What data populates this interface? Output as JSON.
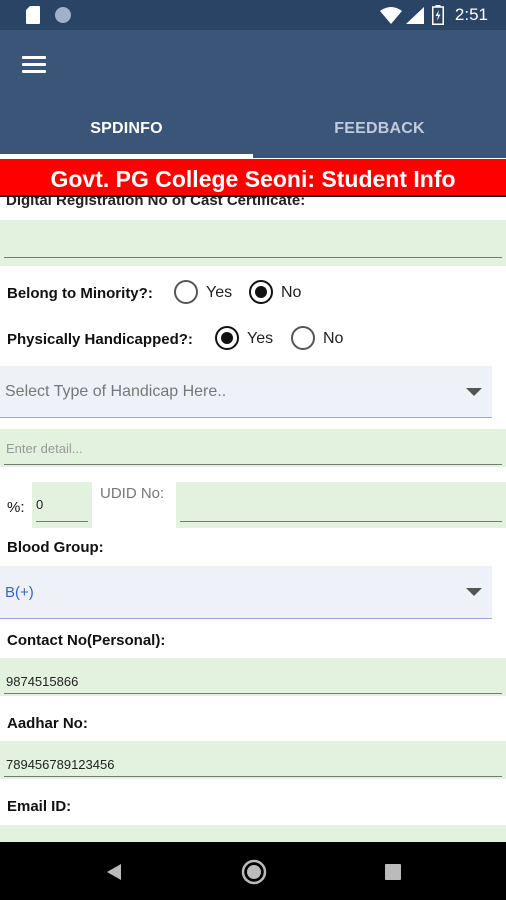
{
  "status_bar": {
    "time": "2:51",
    "left_icons": [
      "sd-card-icon",
      "circle-notification-icon"
    ],
    "right_icons": [
      "wifi-icon",
      "signal-icon",
      "battery-icon"
    ]
  },
  "app_bar": {
    "menu_icon": "hamburger-menu-icon",
    "tabs": [
      {
        "label": "SPDINFO",
        "active": true
      },
      {
        "label": "FEEDBACK",
        "active": false
      }
    ]
  },
  "banner": {
    "title": "Govt. PG College Seoni: Student Info"
  },
  "form": {
    "cut_label": "Digital Registration No of Cast Certificate:",
    "minority": {
      "label": "Belong to Minority?:",
      "options": [
        "Yes",
        "No"
      ],
      "selected": "No"
    },
    "handicapped": {
      "label": "Physically Handicapped?:",
      "options": [
        "Yes",
        "No"
      ],
      "selected": "Yes"
    },
    "handicap_type": {
      "placeholder": "Select Type of Handicap Here.."
    },
    "detail": {
      "placeholder": "Enter detail..."
    },
    "percent": {
      "label": "%:",
      "value": "0"
    },
    "udid": {
      "label": "UDID No:",
      "value": ""
    },
    "blood_group": {
      "label": "Blood Group:",
      "value": "B(+)"
    },
    "contact": {
      "label": "Contact No(Personal):",
      "value": "9874515866"
    },
    "aadhar": {
      "label": "Aadhar No:",
      "value": "789456789123456"
    },
    "email": {
      "label": "Email ID:",
      "value": ""
    }
  },
  "colors": {
    "status_bar": "#2a4466",
    "app_bar": "#3b5578",
    "banner": "#ff0000",
    "field_green": "#e3f2df",
    "spinner_bg": "#eef1f8",
    "blood_value": "#3366cc"
  },
  "nav_bar": {
    "icons": [
      "back-icon",
      "home-icon",
      "recents-icon"
    ]
  }
}
